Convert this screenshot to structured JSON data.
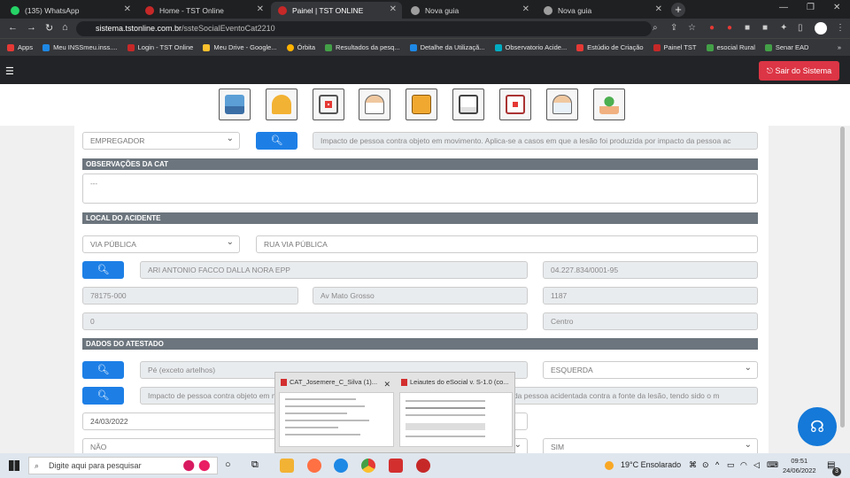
{
  "browser": {
    "tabs": [
      {
        "title": "(135) WhatsApp",
        "active": false,
        "color": "#25d366"
      },
      {
        "title": "Home - TST Online",
        "active": false,
        "color": "#c62828"
      },
      {
        "title": "Painel | TST ONLINE",
        "active": true,
        "color": "#c62828"
      },
      {
        "title": "Nova guia",
        "active": false,
        "color": "#9e9e9e"
      },
      {
        "title": "Nova guia",
        "active": false,
        "color": "#9e9e9e"
      }
    ],
    "new_tab": "+",
    "url_host": "sistema.tstonline.com.br",
    "url_path": "/ssteSocialEventoCat2210",
    "bookmarks": [
      {
        "label": "Apps",
        "color": "#e53935"
      },
      {
        "label": "Meu INSSmeu.inss....",
        "color": "#1e88e5"
      },
      {
        "label": "Login - TST Online",
        "color": "#c62828"
      },
      {
        "label": "Meu Drive - Google...",
        "color": "#fbc02d"
      },
      {
        "label": "Órbita",
        "color": "#ffb300"
      },
      {
        "label": "Resultados da pesq...",
        "color": "#43a047"
      },
      {
        "label": "Detalhe da Utilizaçã...",
        "color": "#1e88e5"
      },
      {
        "label": "Observatorio Acide...",
        "color": "#00acc1"
      },
      {
        "label": "Estúdio de Criação",
        "color": "#e53935"
      },
      {
        "label": "Painel TST",
        "color": "#c62828"
      },
      {
        "label": "esocial Rural",
        "color": "#43a047"
      },
      {
        "label": "Senar EAD",
        "color": "#43a047"
      }
    ],
    "bookmarks_more": "»"
  },
  "app": {
    "logout_label": "Sair do Sistema",
    "toolbar_icons": [
      "building-icon",
      "helmet-icon",
      "medical-record-icon",
      "doctor-icon",
      "folder-icon",
      "clipboard-icon",
      "medical-clipboard-icon",
      "physician-icon",
      "plant-hands-icon"
    ]
  },
  "form": {
    "agente_select": "EMPREGADOR",
    "agente_desc": "Impacto de pessoa contra objeto em movimento. Aplica-se a casos em que a lesão foi produzida por impacto da pessoa ac",
    "obs_title": "OBSERVAÇÕES DA CAT",
    "obs_value": "---",
    "local_title": "LOCAL DO ACIDENTE",
    "local_tipo": "VIA PÚBLICA",
    "local_desc": "RUA VIA PÚBLICA",
    "empresa_nome": "ARI ANTONIO FACCO DALLA NORA EPP",
    "empresa_cnpj": "04.227.834/0001-95",
    "cep": "78175-000",
    "logradouro": "Av Mato Grosso",
    "numero": "1187",
    "complemento": "0",
    "bairro": "Centro",
    "atestado_title": "DADOS DO ATESTADO",
    "parte_corpo": "Pé (exceto artelhos)",
    "lateralidade": "ESQUERDA",
    "natureza": "Impacto de pessoa contra objeto em movimento. Aplica-se a casos em que a lesão foi produzida por impacto da pessoa acidentada contra a fonte da lesão, tendo sido o m",
    "data_atendimento": "24/03/2022",
    "internacao": "NÃO",
    "afastamento": "SIM"
  },
  "preview": [
    {
      "title": "CAT_Josemere_C_Silva (1)..."
    },
    {
      "title": "Leiautes do eSocial v. S-1.0 (co..."
    }
  ],
  "taskbar": {
    "search_placeholder": "Digite aqui para pesquisar",
    "weather": "19°C  Ensolarado",
    "time": "09:51",
    "date": "24/06/2022",
    "notif_count": "3"
  }
}
